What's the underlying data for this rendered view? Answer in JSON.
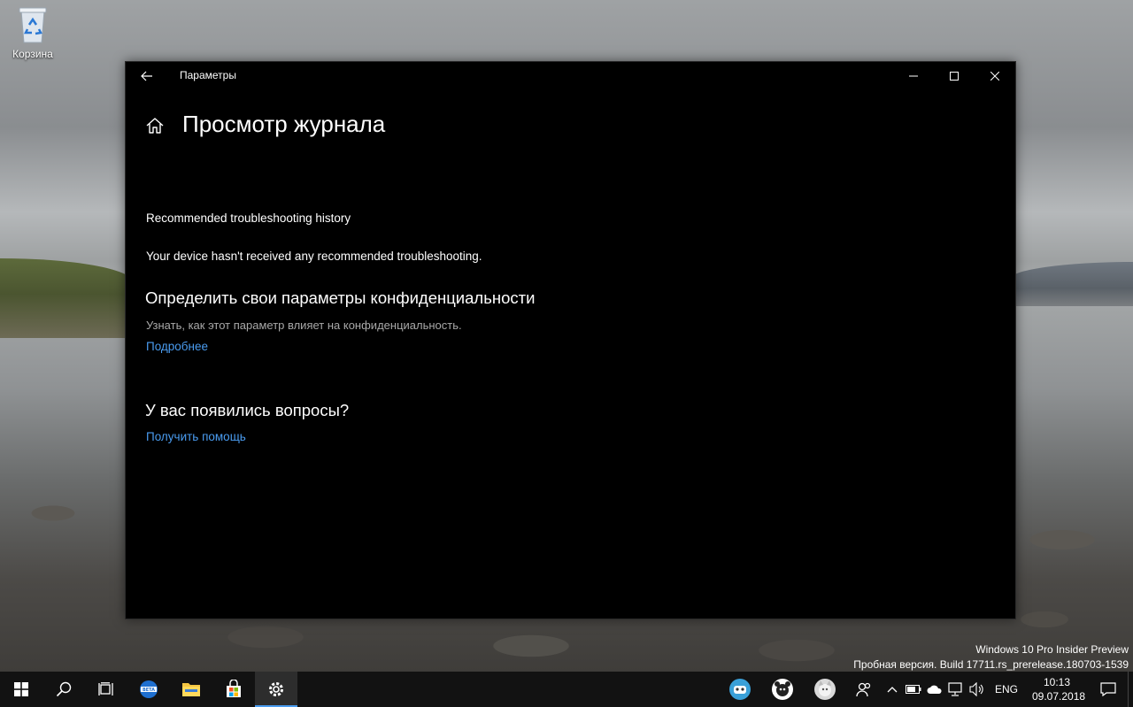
{
  "desktop": {
    "recycle_bin_label": "Корзина"
  },
  "window": {
    "title": "Параметры",
    "page_title": "Просмотр журнала",
    "history_label": "Recommended troubleshooting history",
    "history_body": "Your device hasn't received any recommended troubleshooting.",
    "privacy_heading": "Определить свои параметры конфиденциальности",
    "privacy_desc": "Узнать, как этот параметр влияет на конфиденциальность.",
    "privacy_link": "Подробнее",
    "questions_heading": "У вас появились вопросы?",
    "help_link": "Получить помощь"
  },
  "watermark": {
    "line1": "Windows 10 Pro Insider Preview",
    "line2": "Пробная версия. Build 17711.rs_prerelease.180703-1539"
  },
  "taskbar": {
    "pinned": [
      "start-icon",
      "search-icon",
      "task-view-icon",
      "edge-beta-icon",
      "file-explorer-icon",
      "store-icon",
      "settings-icon"
    ],
    "tray_apps": [
      "mascot-app-icon",
      "bear-app-icon",
      "cat-app-icon"
    ],
    "tray_icons": [
      "people-icon",
      "chevron-up-icon",
      "battery-icon",
      "onedrive-icon",
      "network-icon",
      "volume-icon"
    ],
    "language": "ENG",
    "time": "10:13",
    "date": "09.07.2018"
  },
  "colors": {
    "accent_link": "#4a9cf0",
    "window_bg": "#000000",
    "taskbar_bg": "#121212"
  }
}
